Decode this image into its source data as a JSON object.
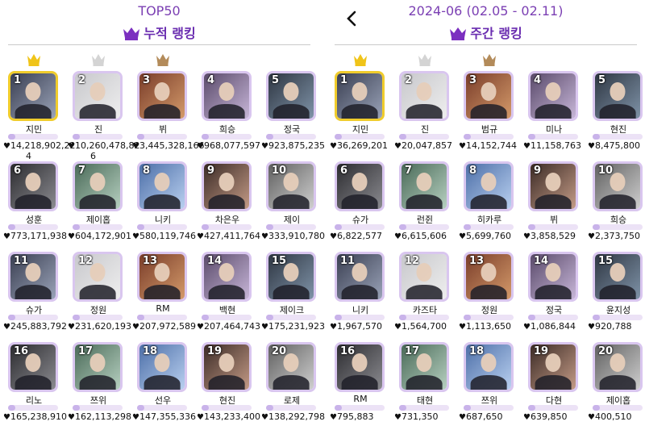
{
  "left": {
    "title": "TOP50",
    "subtitle": "누적 랭킹",
    "items": [
      {
        "rank": "1",
        "name": "지민",
        "votes": "14,218,902,22",
        "ext": "4",
        "medal": "gold",
        "top": true
      },
      {
        "rank": "2",
        "name": "진",
        "votes": "10,260,478,82",
        "ext": "6",
        "medal": "silver"
      },
      {
        "rank": "3",
        "name": "뷔",
        "votes": "3,445,328,166",
        "medal": "bronze"
      },
      {
        "rank": "4",
        "name": "희승",
        "votes": "968,077,597"
      },
      {
        "rank": "5",
        "name": "정국",
        "votes": "923,875,235"
      },
      {
        "rank": "6",
        "name": "성훈",
        "votes": "773,171,938"
      },
      {
        "rank": "7",
        "name": "제이홉",
        "votes": "604,172,901"
      },
      {
        "rank": "8",
        "name": "니키",
        "votes": "580,119,746"
      },
      {
        "rank": "9",
        "name": "차은우",
        "votes": "427,411,764"
      },
      {
        "rank": "10",
        "name": "제이",
        "votes": "333,910,780"
      },
      {
        "rank": "11",
        "name": "슈가",
        "votes": "245,883,792"
      },
      {
        "rank": "12",
        "name": "정원",
        "votes": "231,620,193"
      },
      {
        "rank": "13",
        "name": "RM",
        "votes": "207,972,589"
      },
      {
        "rank": "14",
        "name": "백현",
        "votes": "207,464,743"
      },
      {
        "rank": "15",
        "name": "제이크",
        "votes": "175,231,923"
      },
      {
        "rank": "16",
        "name": "리노",
        "votes": "165,238,910"
      },
      {
        "rank": "17",
        "name": "쯔위",
        "votes": "162,113,298"
      },
      {
        "rank": "18",
        "name": "선우",
        "votes": "147,355,336"
      },
      {
        "rank": "19",
        "name": "현진",
        "votes": "143,233,400"
      },
      {
        "rank": "20",
        "name": "로제",
        "votes": "138,292,798"
      }
    ]
  },
  "right": {
    "back_icon": "chevron-left-icon",
    "title": "2024-06 (02.05 - 02.11)",
    "subtitle": "주간 랭킹",
    "items": [
      {
        "rank": "1",
        "name": "지민",
        "votes": "36,269,201",
        "medal": "gold",
        "top": true
      },
      {
        "rank": "2",
        "name": "진",
        "votes": "20,047,857",
        "medal": "silver"
      },
      {
        "rank": "3",
        "name": "범규",
        "votes": "14,152,744",
        "medal": "bronze"
      },
      {
        "rank": "4",
        "name": "미나",
        "votes": "11,158,763"
      },
      {
        "rank": "5",
        "name": "현진",
        "votes": "8,475,800"
      },
      {
        "rank": "6",
        "name": "슈가",
        "votes": "6,822,577"
      },
      {
        "rank": "7",
        "name": "런쥔",
        "votes": "6,615,606"
      },
      {
        "rank": "8",
        "name": "히카루",
        "votes": "5,699,760"
      },
      {
        "rank": "9",
        "name": "뷔",
        "votes": "3,858,529"
      },
      {
        "rank": "10",
        "name": "희승",
        "votes": "2,373,750"
      },
      {
        "rank": "11",
        "name": "니키",
        "votes": "1,967,570"
      },
      {
        "rank": "12",
        "name": "카즈타",
        "votes": "1,564,700"
      },
      {
        "rank": "13",
        "name": "정원",
        "votes": "1,113,650"
      },
      {
        "rank": "14",
        "name": "정국",
        "votes": "1,086,844"
      },
      {
        "rank": "15",
        "name": "윤지성",
        "votes": "920,788"
      },
      {
        "rank": "16",
        "name": "RM",
        "votes": "795,883"
      },
      {
        "rank": "17",
        "name": "태현",
        "votes": "731,350"
      },
      {
        "rank": "18",
        "name": "쯔위",
        "votes": "687,650"
      },
      {
        "rank": "19",
        "name": "다현",
        "votes": "639,850"
      },
      {
        "rank": "20",
        "name": "제이홉",
        "votes": "400,510"
      }
    ]
  },
  "colors": {
    "accent": "#6a2db0",
    "title": "#7b3fb3",
    "gold": "#f0c419",
    "silver": "#d4d4d4",
    "bronze": "#b38b5a",
    "card_border": "#d9c6ef",
    "gold_border": "#f0cc2c"
  },
  "icons": {
    "medal": "crown-icon",
    "heart": "heart-icon"
  }
}
